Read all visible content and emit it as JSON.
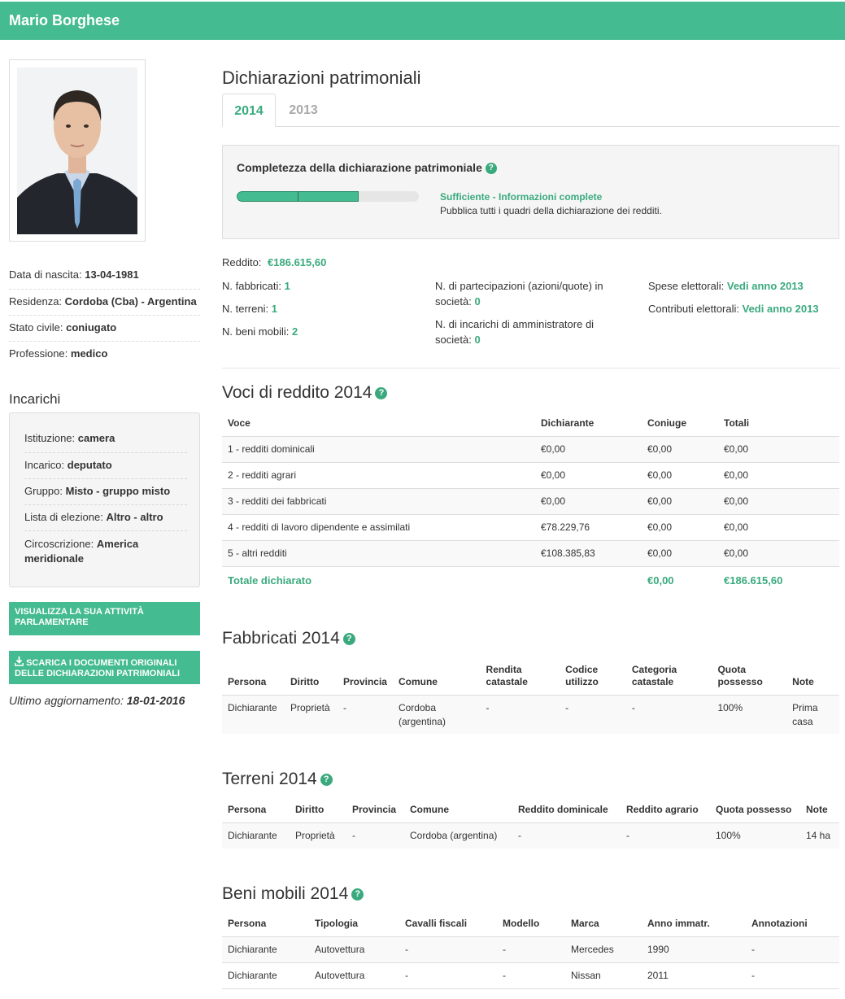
{
  "header": {
    "title": "Mario Borghese"
  },
  "profile": {
    "birth_label": "Data di nascita:",
    "birth_value": "13-04-1981",
    "residence_label": "Residenza:",
    "residence_value": "Cordoba (Cba) - Argentina",
    "civil_label": "Stato civile:",
    "civil_value": "coniugato",
    "job_label": "Professione:",
    "job_value": "medico"
  },
  "incarichi": {
    "title": "Incarichi",
    "istituzione_label": "Istituzione:",
    "istituzione_value": "camera",
    "incarico_label": "Incarico:",
    "incarico_value": "deputato",
    "gruppo_label": "Gruppo:",
    "gruppo_value": "Misto - gruppo misto",
    "lista_label": "Lista di elezione:",
    "lista_value": "Altro - altro",
    "circ_label": "Circoscrizione:",
    "circ_value": "America meridionale"
  },
  "buttons": {
    "activity": "Visualizza la sua attività parlamentare",
    "download": "Scarica i documenti originali delle dichiarazioni patrimoniali"
  },
  "update": {
    "label": "Ultimo aggiornamento:",
    "value": "18-01-2016"
  },
  "main": {
    "title": "Dichiarazioni patrimoniali",
    "tabs": [
      "2014",
      "2013"
    ],
    "completeness": {
      "title": "Completezza della dichiarazione patrimoniale",
      "progress": 0.67,
      "status": "Sufficiente - Informazioni complete",
      "description": "Pubblica tutti i quadri della dichiarazione dei redditi."
    },
    "summary": {
      "reddito_label": "Reddito:",
      "reddito_value": "€186.615,60",
      "fabbricati_label": "N. fabbricati:",
      "fabbricati_value": "1",
      "terreni_label": "N. terreni:",
      "terreni_value": "1",
      "beni_label": "N. beni mobili:",
      "beni_value": "2",
      "partecipazioni_label": "N. di partecipazioni (azioni/quote) in società:",
      "partecipazioni_value": "0",
      "amministratore_label": "N. di incarichi di amministratore di società:",
      "amministratore_value": "0",
      "spese_label": "Spese elettorali:",
      "spese_value": "Vedi anno 2013",
      "contributi_label": "Contributi elettorali:",
      "contributi_value": "Vedi anno 2013"
    }
  },
  "redditi": {
    "title": "Voci di reddito 2014",
    "headers": [
      "Voce",
      "Dichiarante",
      "Coniuge",
      "Totali"
    ],
    "rows": [
      [
        "1 - redditi dominicali",
        "€0,00",
        "€0,00",
        "€0,00"
      ],
      [
        "2 - redditi agrari",
        "€0,00",
        "€0,00",
        "€0,00"
      ],
      [
        "3 - redditi dei fabbricati",
        "€0,00",
        "€0,00",
        "€0,00"
      ],
      [
        "4 - redditi di lavoro dipendente e assimilati",
        "€78.229,76",
        "€0,00",
        "€0,00"
      ],
      [
        "5 - altri redditi",
        "€108.385,83",
        "€0,00",
        "€0,00"
      ]
    ],
    "total": [
      "Totale dichiarato",
      "",
      "€0,00",
      "€186.615,60"
    ]
  },
  "fabbricati": {
    "title": "Fabbricati 2014",
    "headers": [
      "Persona",
      "Diritto",
      "Provincia",
      "Comune",
      "Rendita catastale",
      "Codice utilizzo",
      "Categoria catastale",
      "Quota possesso",
      "Note"
    ],
    "rows": [
      [
        "Dichiarante",
        "Proprietà",
        "-",
        "Cordoba (argentina)",
        "-",
        "-",
        "-",
        "100%",
        "Prima casa"
      ]
    ]
  },
  "terreni": {
    "title": "Terreni 2014",
    "headers": [
      "Persona",
      "Diritto",
      "Provincia",
      "Comune",
      "Reddito dominicale",
      "Reddito agrario",
      "Quota possesso",
      "Note"
    ],
    "rows": [
      [
        "Dichiarante",
        "Proprietà",
        "-",
        "Cordoba (argentina)",
        "-",
        "-",
        "100%",
        "14 ha"
      ]
    ]
  },
  "beni": {
    "title": "Beni mobili 2014",
    "headers": [
      "Persona",
      "Tipologia",
      "Cavalli fiscali",
      "Modello",
      "Marca",
      "Anno immatr.",
      "Annotazioni"
    ],
    "rows": [
      [
        "Dichiarante",
        "Autovettura",
        "-",
        "-",
        "Mercedes",
        "1990",
        "-"
      ],
      [
        "Dichiarante",
        "Autovettura",
        "-",
        "-",
        "Nissan",
        "2011",
        "-"
      ]
    ]
  },
  "icons": {
    "help": "question-circle-icon",
    "download": "download-icon"
  },
  "colors": {
    "accent": "#44bb91",
    "accent_text": "#3aaa7e"
  }
}
